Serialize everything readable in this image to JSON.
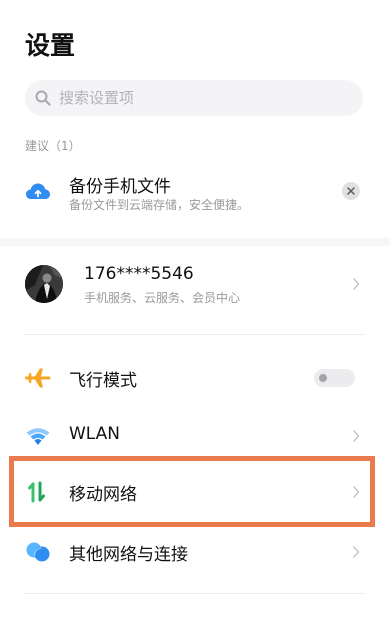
{
  "header": {
    "title": "设置"
  },
  "search": {
    "placeholder": "搜索设置项"
  },
  "suggestions": {
    "section_label": "建议（1）",
    "items": [
      {
        "title": "备份手机文件",
        "subtitle": "备份文件到云端存储，安全便捷。",
        "icon": "cloud-upload-icon"
      }
    ]
  },
  "account": {
    "name": "176****5546",
    "subtitle": "手机服务、云服务、会员中心"
  },
  "settings": [
    {
      "label": "飞行模式",
      "icon": "airplane-icon",
      "control": "toggle",
      "toggle_on": false
    },
    {
      "label": "WLAN",
      "icon": "wifi-icon",
      "control": "chevron"
    },
    {
      "label": "移动网络",
      "icon": "mobile-data-icon",
      "control": "chevron",
      "highlighted": true
    },
    {
      "label": "其他网络与连接",
      "icon": "connections-icon",
      "control": "chevron"
    }
  ],
  "colors": {
    "accent_blue": "#2f8cf0",
    "airplane_orange": "#f5a623",
    "mobile_green": "#36c46b",
    "highlight_border": "#ea7a4c"
  }
}
